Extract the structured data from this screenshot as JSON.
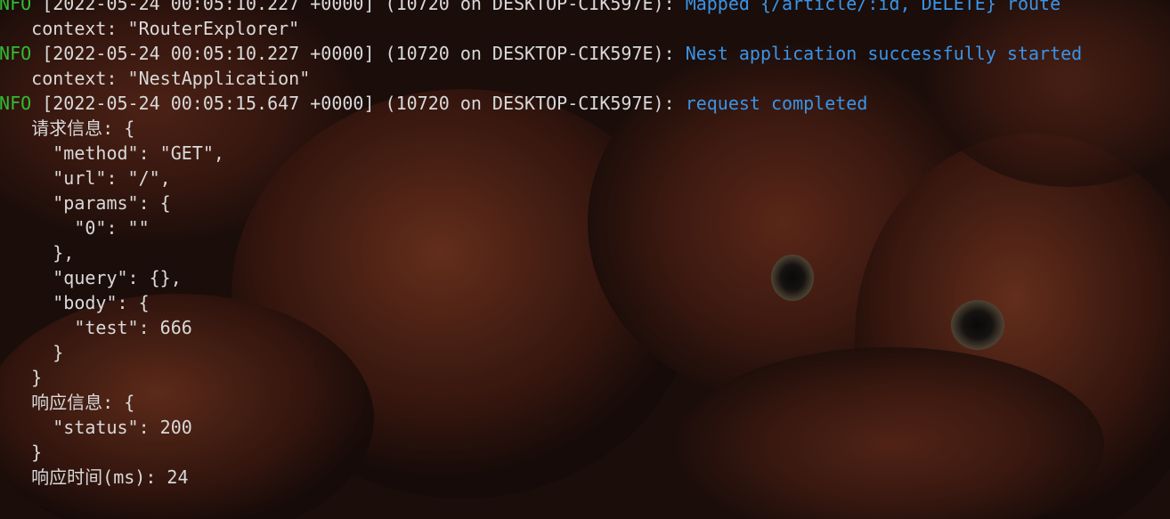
{
  "colors": {
    "text": "#d9d9d9",
    "level": "#33bb33",
    "message": "#3b94e6"
  },
  "entries": [
    {
      "level": "INFO",
      "meta": " [2022-05-24 00:05:10.227 +0000] (10720 on DESKTOP-CIK597E): ",
      "message": "Mapped {/article/:id, DELETE} route"
    },
    {
      "text": "    context: \"RouterExplorer\""
    },
    {
      "level": "INFO",
      "meta": " [2022-05-24 00:05:10.227 +0000] (10720 on DESKTOP-CIK597E): ",
      "message": "Nest application successfully started"
    },
    {
      "text": "    context: \"NestApplication\""
    },
    {
      "level": "INFO",
      "meta": " [2022-05-24 00:05:15.647 +0000] (10720 on DESKTOP-CIK597E): ",
      "message": "request completed"
    },
    {
      "text": "    请求信息: {"
    },
    {
      "text": "      \"method\": \"GET\","
    },
    {
      "text": "      \"url\": \"/\","
    },
    {
      "text": "      \"params\": {"
    },
    {
      "text": "        \"0\": \"\""
    },
    {
      "text": "      },"
    },
    {
      "text": "      \"query\": {},"
    },
    {
      "text": "      \"body\": {"
    },
    {
      "text": "        \"test\": 666"
    },
    {
      "text": "      }"
    },
    {
      "text": "    }"
    },
    {
      "text": "    响应信息: {"
    },
    {
      "text": "      \"status\": 200"
    },
    {
      "text": "    }"
    },
    {
      "text": "    响应时间(ms): 24"
    }
  ]
}
